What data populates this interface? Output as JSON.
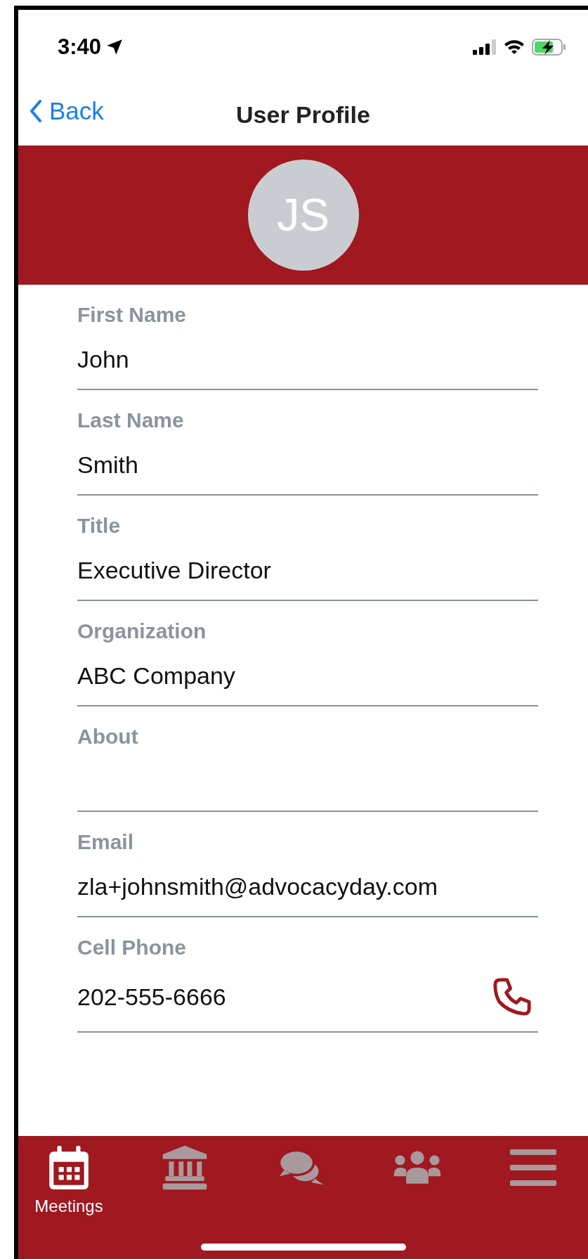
{
  "status_bar": {
    "time": "3:40"
  },
  "nav": {
    "back": "Back",
    "title": "User Profile"
  },
  "profile": {
    "initials": "JS"
  },
  "fields": [
    {
      "label": "First Name",
      "value": "John"
    },
    {
      "label": "Last Name",
      "value": "Smith"
    },
    {
      "label": "Title",
      "value": "Executive Director"
    },
    {
      "label": "Organization",
      "value": "ABC Company"
    },
    {
      "label": "About"
    },
    {
      "label": "Email",
      "value": "zla+johnsmith@advocacyday.com"
    },
    {
      "label": "Cell Phone",
      "value": "202-555-6666",
      "call_button": true
    }
  ],
  "tabs": [
    {
      "kind": "calendar",
      "label": "Meetings",
      "selected": true
    },
    {
      "kind": "building",
      "selected": false
    },
    {
      "kind": "chat",
      "selected": false
    },
    {
      "kind": "people",
      "selected": false
    },
    {
      "kind": "menu",
      "selected": false
    }
  ]
}
